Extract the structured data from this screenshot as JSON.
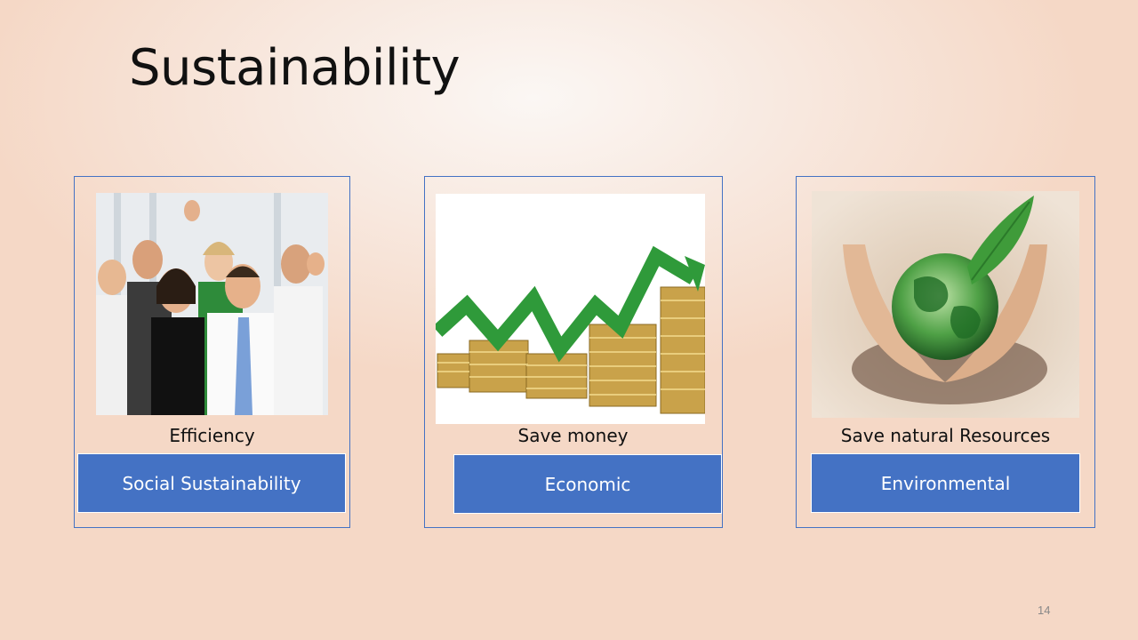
{
  "slide": {
    "title": "Sustainability",
    "page_number": "14"
  },
  "cards": [
    {
      "caption": "Efficiency",
      "label": "Social Sustainability",
      "image": "people-celebrating-image"
    },
    {
      "caption": "Save money",
      "label": "Economic",
      "image": "coins-growth-chart-image"
    },
    {
      "caption": "Save natural Resources",
      "label": "Environmental",
      "image": "hands-holding-globe-image"
    }
  ],
  "colors": {
    "accent": "#4472c4",
    "border": "#4472c4"
  }
}
